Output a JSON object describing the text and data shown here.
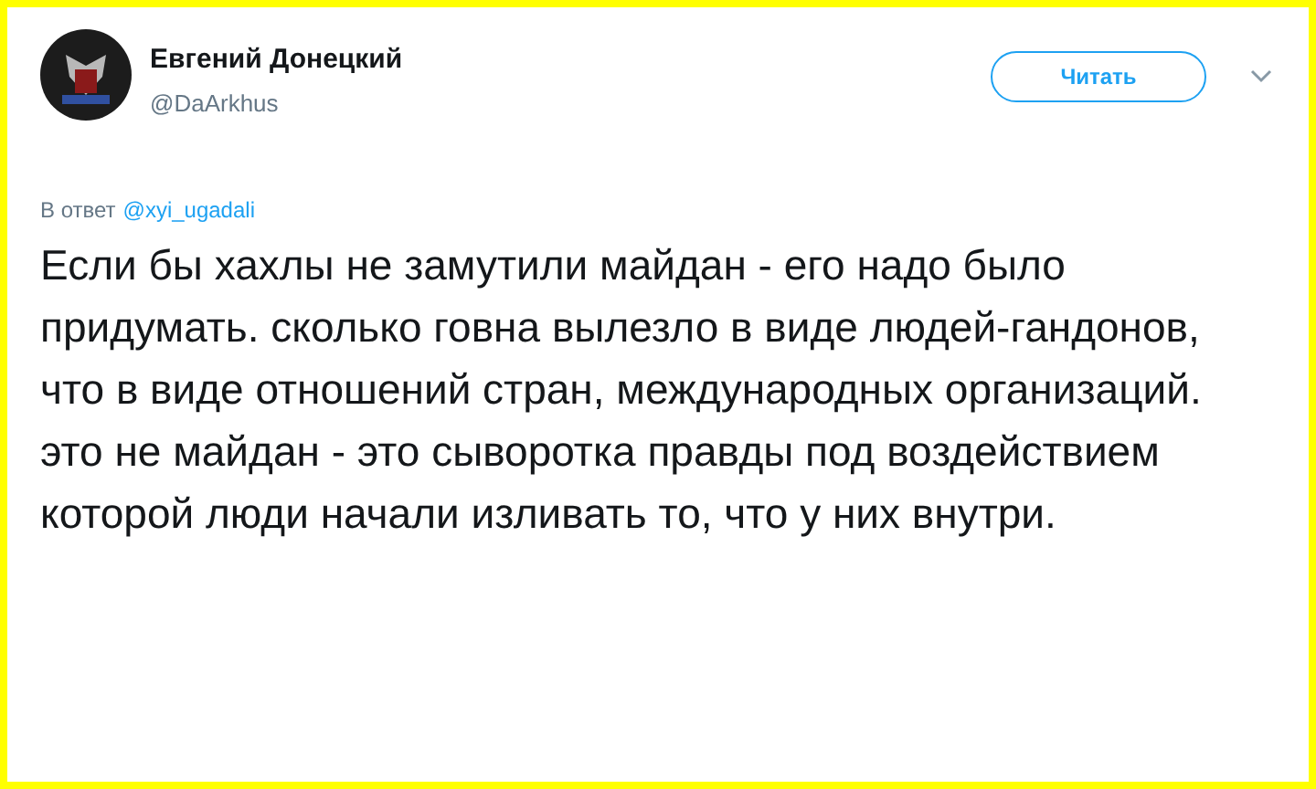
{
  "author": {
    "name": "Евгений Донецкий",
    "handle": "@DaArkhus"
  },
  "follow_button": {
    "label": "Читать"
  },
  "reply_to": {
    "prefix": "В ответ",
    "user": "@xyi_ugadali"
  },
  "tweet_text": "Если бы хахлы не замутили майдан - его надо было придумать. сколько говна вылезло в виде людей-гандонов, что в виде отношений стран, международных организаций. это не майдан - это сыворотка правды под воздействием которой люди начали изливать то, что у них внутри."
}
